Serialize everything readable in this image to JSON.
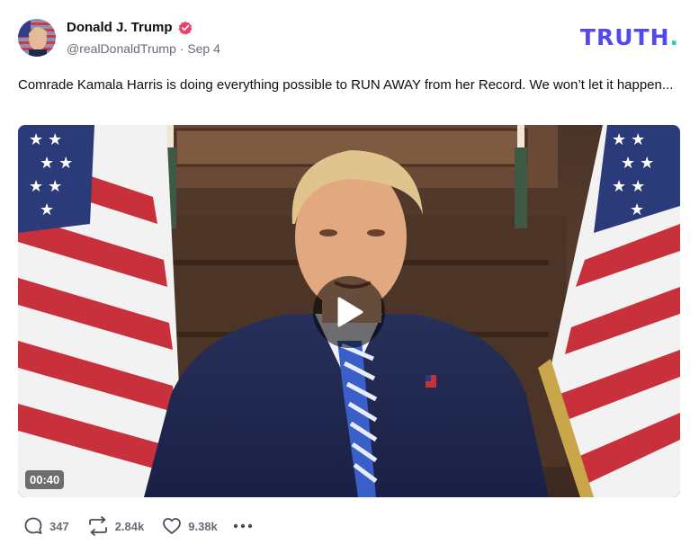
{
  "author": {
    "display_name": "Donald J. Trump",
    "handle": "@realDonaldTrump",
    "timestamp": "Sep 4",
    "verified_icon": "verified-badge-icon",
    "verified_color": "#f03e6a"
  },
  "brand": {
    "logo_text": "TRUTH",
    "logo_dot": ".",
    "logo_color": "#5448ee",
    "dot_color": "#22d3a5"
  },
  "post": {
    "text": "Comrade Kamala Harris is doing everything possible to RUN AWAY from her Record. We won’t let it happen..."
  },
  "media": {
    "type": "video",
    "duration": "00:40",
    "play_icon": "play-icon"
  },
  "actions": {
    "replies": {
      "icon": "reply-bubble-icon",
      "count": "347"
    },
    "retruths": {
      "icon": "retruth-icon",
      "count": "2.84k"
    },
    "likes": {
      "icon": "heart-icon",
      "count": "9.38k"
    },
    "more": {
      "icon": "more-dots-icon"
    }
  }
}
